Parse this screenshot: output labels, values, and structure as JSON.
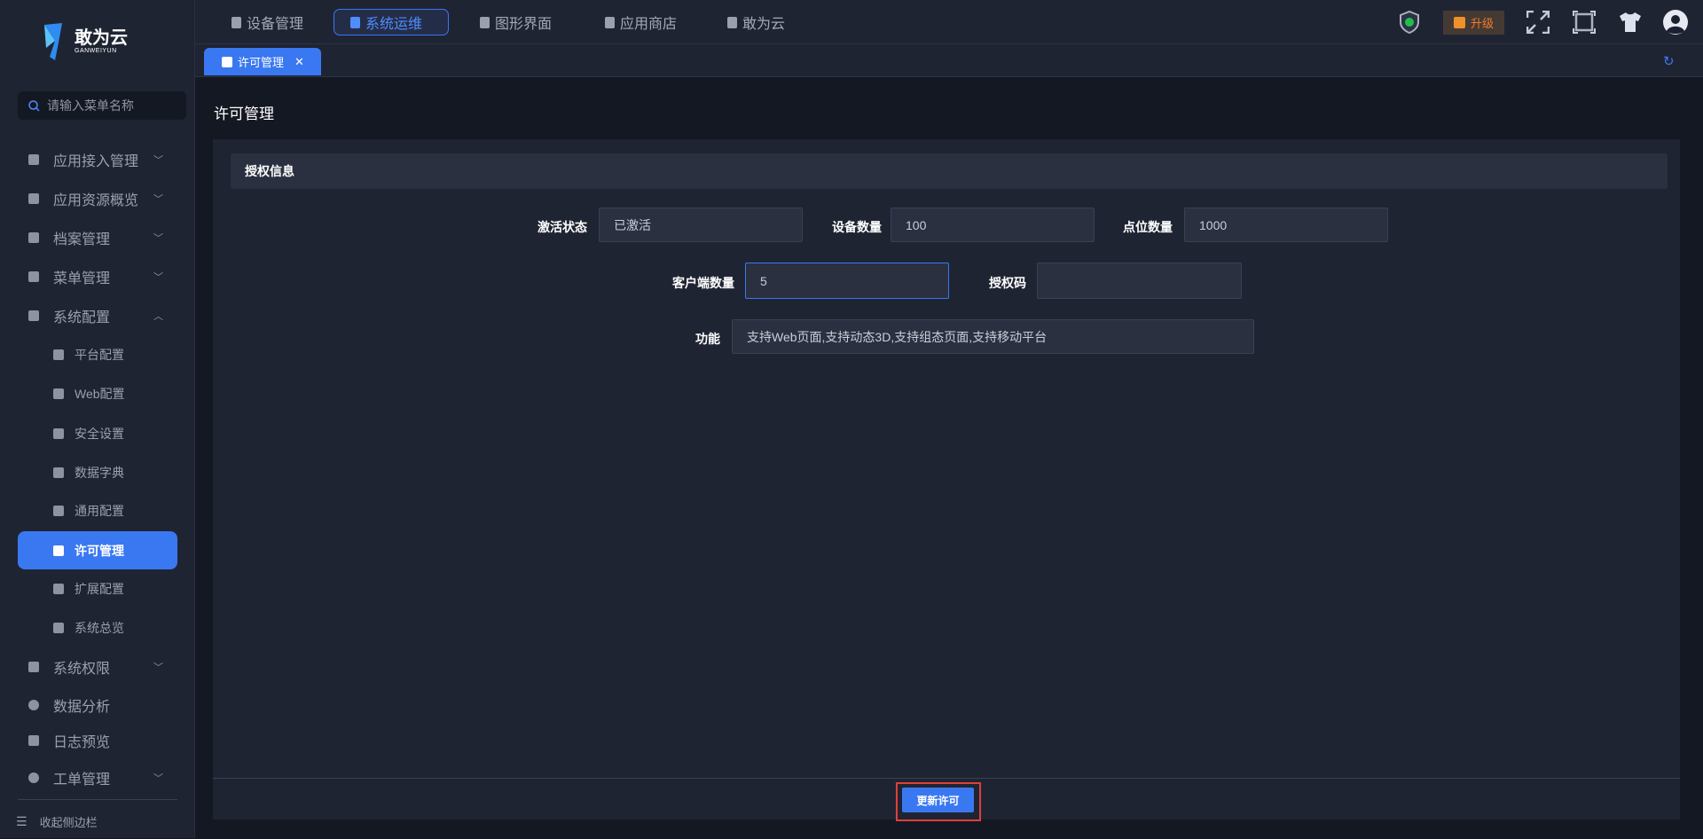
{
  "logo": {
    "name": "敢为云",
    "sub": "GANWEIYUN"
  },
  "search": {
    "placeholder": "请输入菜单名称"
  },
  "sidebar": {
    "items": [
      {
        "label": "应用接入管理",
        "icon": "home-icon",
        "chev": "﹀"
      },
      {
        "label": "应用资源概览",
        "icon": "layers-icon",
        "chev": "﹀"
      },
      {
        "label": "档案管理",
        "icon": "archive-icon",
        "chev": "﹀"
      },
      {
        "label": "菜单管理",
        "icon": "table-icon",
        "chev": "﹀"
      },
      {
        "label": "系统配置",
        "icon": "home-icon",
        "chev": "︿"
      }
    ],
    "subitems": [
      {
        "label": "平台配置",
        "icon": "camera-icon"
      },
      {
        "label": "Web配置",
        "icon": "monitor-icon"
      },
      {
        "label": "安全设置",
        "icon": "shield-icon"
      },
      {
        "label": "数据字典",
        "icon": "chart-icon"
      },
      {
        "label": "通用配置",
        "icon": "blocks-icon"
      },
      {
        "label": "许可管理",
        "icon": "user-icon"
      },
      {
        "label": "扩展配置",
        "icon": "puzzle-icon"
      },
      {
        "label": "系统总览",
        "icon": "home-icon"
      }
    ],
    "items2": [
      {
        "label": "系统权限",
        "icon": "lock-shield-icon",
        "chev": "﹀"
      },
      {
        "label": "数据分析",
        "icon": "pie-icon"
      },
      {
        "label": "日志预览",
        "icon": "log-icon"
      },
      {
        "label": "工单管理",
        "icon": "gear-icon",
        "chev": "﹀"
      }
    ],
    "collapse": "收起侧边栏"
  },
  "topnav": [
    {
      "label": "设备管理"
    },
    {
      "label": "系统运维"
    },
    {
      "label": "图形界面"
    },
    {
      "label": "应用商店"
    },
    {
      "label": "敢为云"
    }
  ],
  "upgrade": "升级",
  "tabs": [
    {
      "label": "许可管理",
      "close": "✕"
    }
  ],
  "page": {
    "title": "许可管理",
    "section": "授权信息",
    "fields": {
      "activation": {
        "label": "激活状态",
        "value": "已激活"
      },
      "devices": {
        "label": "设备数量",
        "value": "100"
      },
      "points": {
        "label": "点位数量",
        "value": "1000"
      },
      "clients": {
        "label": "客户端数量",
        "value": "5"
      },
      "code": {
        "label": "授权码",
        "value": ""
      },
      "features": {
        "label": "功能",
        "value": "支持Web页面,支持动态3D,支持组态页面,支持移动平台"
      }
    },
    "update_button": "更新许可"
  },
  "colors": {
    "accent": "#3a78f2",
    "highlight": "#e0403a",
    "upgrade": "#f07b2c"
  }
}
